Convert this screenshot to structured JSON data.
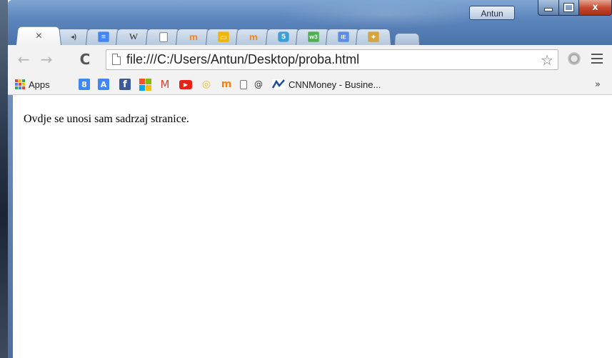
{
  "window": {
    "profile_name": "Antun",
    "controls": {
      "minimize": "—",
      "maximize": "□",
      "close": "x"
    }
  },
  "tabs": [
    {
      "kind": "active",
      "close_glyph": "×"
    },
    {
      "kind": "audio",
      "icon": "speaker-icon",
      "glyph": "◂)"
    },
    {
      "kind": "docs",
      "icon": "google-docs-icon",
      "color": "#4285f4",
      "glyph": "≡"
    },
    {
      "kind": "wikipedia",
      "icon": "wikipedia-icon",
      "glyph": "W"
    },
    {
      "kind": "blank",
      "icon": "page-icon"
    },
    {
      "kind": "moodle",
      "icon": "moodle-icon",
      "color": "#f98012",
      "glyph": "m"
    },
    {
      "kind": "slides",
      "icon": "google-slides-icon",
      "color": "#f4b400",
      "glyph": "▭"
    },
    {
      "kind": "moodle",
      "icon": "moodle-icon",
      "color": "#f98012",
      "glyph": "m"
    },
    {
      "kind": "html5",
      "icon": "html5-icon",
      "color": "#3d9dd6",
      "glyph": "5"
    },
    {
      "kind": "w3",
      "icon": "w3schools-icon",
      "color": "#4caf50",
      "glyph": "w3"
    },
    {
      "kind": "ext",
      "icon": "extension-icon",
      "color": "#5b8ee0",
      "glyph": "IE"
    },
    {
      "kind": "puzzle",
      "icon": "puzzle-icon",
      "color": "#d5a43b",
      "glyph": "✦"
    }
  ],
  "toolbar": {
    "url": "file:///C:/Users/Antun/Desktop/proba.html",
    "back_glyph": "←",
    "forward_glyph": "→",
    "reload_glyph": "C",
    "star_glyph": "☆"
  },
  "bookmarks": {
    "apps_label": "Apps",
    "items": [
      {
        "icon": "google-plus-icon",
        "color": "#4285f4",
        "glyph": "8"
      },
      {
        "icon": "translate-icon",
        "color": "#4285f4",
        "glyph": "A"
      },
      {
        "icon": "facebook-icon",
        "color": "#3b5998",
        "glyph": "f"
      },
      {
        "icon": "microsoft-icon"
      },
      {
        "icon": "gmail-icon",
        "color": "#d44638",
        "glyph": "M"
      },
      {
        "icon": "youtube-icon",
        "color": "#e62117",
        "glyph": "▶"
      },
      {
        "icon": "lollipop-icon",
        "color": "#f3b52b",
        "glyph": "◎"
      },
      {
        "icon": "moodle-icon",
        "color": "#f98012",
        "glyph": "m"
      },
      {
        "icon": "page-icon"
      },
      {
        "icon": "at-icon",
        "glyph": "@"
      }
    ],
    "cnn_label": "CNNMoney - Busine...",
    "more_glyph": "»"
  },
  "content": {
    "text": "Ovdje se unosi sam sadrzaj stranice."
  }
}
